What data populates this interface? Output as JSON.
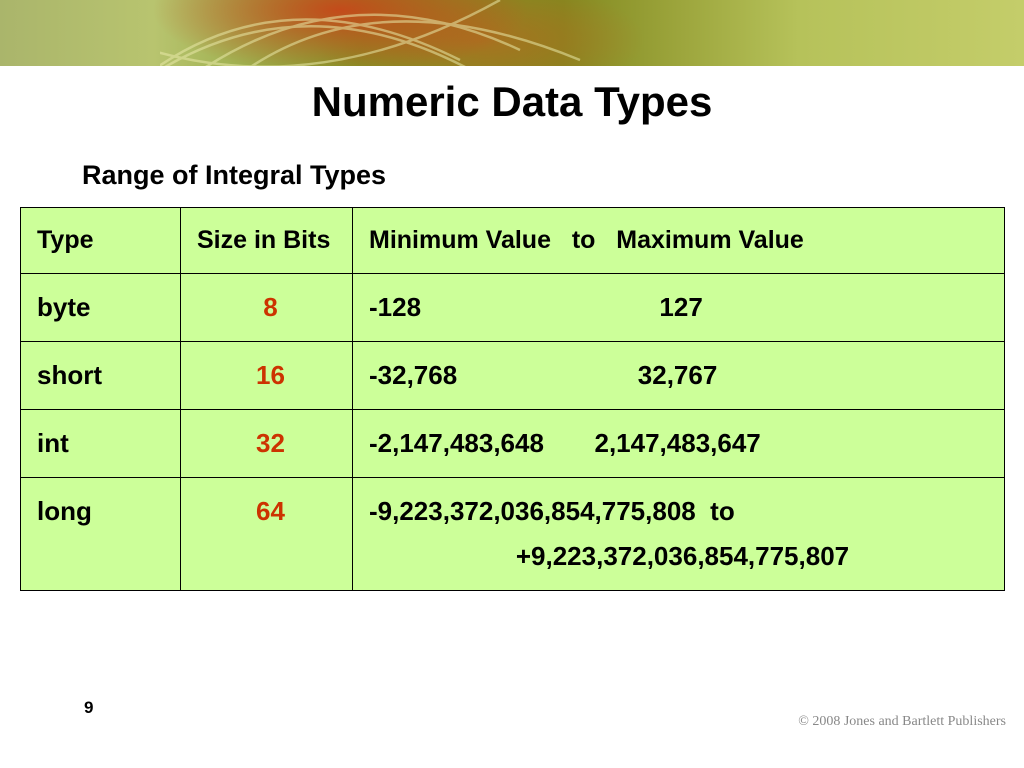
{
  "title": "Numeric Data Types",
  "subtitle": "Range of Integral Types",
  "table": {
    "header": {
      "type": "Type",
      "bits": "Size in Bits",
      "range": "Minimum Value   to   Maximum Value"
    },
    "rows": [
      {
        "type": "byte",
        "bits": "8",
        "range": "-128                                 127"
      },
      {
        "type": "short",
        "bits": "16",
        "range": "-32,768                         32,767"
      },
      {
        "type": "int",
        "bits": "32",
        "range": "-2,147,483,648       2,147,483,647"
      },
      {
        "type": "long",
        "bits": "64",
        "range": "-9,223,372,036,854,775,808  to",
        "range_line2": "+9,223,372,036,854,775,807"
      }
    ]
  },
  "page_number": "9",
  "copyright": "© 2008 Jones and Bartlett Publishers",
  "chart_data": {
    "type": "table",
    "title": "Range of Integral Types",
    "columns": [
      "Type",
      "Size in Bits",
      "Minimum Value",
      "Maximum Value"
    ],
    "rows": [
      [
        "byte",
        8,
        -128,
        127
      ],
      [
        "short",
        16,
        -32768,
        32767
      ],
      [
        "int",
        32,
        -2147483648,
        2147483647
      ],
      [
        "long",
        64,
        "-9,223,372,036,854,775,808",
        "+9,223,372,036,854,775,807"
      ]
    ]
  }
}
